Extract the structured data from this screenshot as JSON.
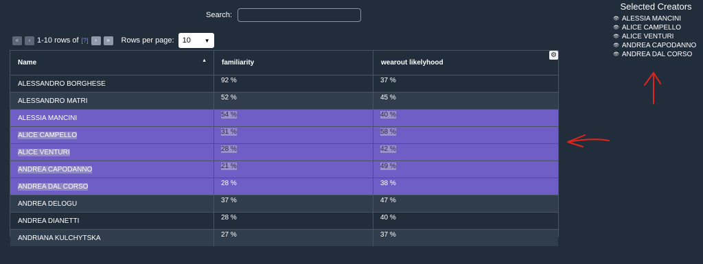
{
  "search": {
    "label": "Search:",
    "value": ""
  },
  "pager": {
    "first_icon": "double-chevron-left",
    "prev_icon": "chevron-left",
    "next_icon": "chevron-right",
    "last_icon": "double-chevron-right",
    "range_text": "1-10 rows of",
    "total_text": "[?]",
    "rows_per_page_label": "Rows per page:",
    "rows_per_page_value": "10"
  },
  "table": {
    "columns": [
      "Name",
      "familiarity",
      "wearout likelyhood"
    ],
    "sort": {
      "column": "Name",
      "direction": "ascending"
    },
    "rows": [
      {
        "name": "ALESSANDRO BORGHESE",
        "familiarity": "92 %",
        "wearout": "37 %",
        "selected": false
      },
      {
        "name": "ALESSANDRO MATRI",
        "familiarity": "52 %",
        "wearout": "45 %",
        "selected": false
      },
      {
        "name": "ALESSIA MANCINI",
        "familiarity": "54 %",
        "wearout": "40 %",
        "selected": true
      },
      {
        "name": "ALICE CAMPELLO",
        "familiarity": "31 %",
        "wearout": "58 %",
        "selected": true
      },
      {
        "name": "ALICE VENTURI",
        "familiarity": "28 %",
        "wearout": "42 %",
        "selected": true
      },
      {
        "name": "ANDREA CAPODANNO",
        "familiarity": "21 %",
        "wearout": "49 %",
        "selected": true
      },
      {
        "name": "ANDREA DAL CORSO",
        "familiarity": "28 %",
        "wearout": "38 %",
        "selected": true
      },
      {
        "name": "ANDREA DELOGU",
        "familiarity": "37 %",
        "wearout": "47 %",
        "selected": false
      },
      {
        "name": "ANDREA DIANETTI",
        "familiarity": "28 %",
        "wearout": "40 %",
        "selected": false
      },
      {
        "name": "ANDRIANA KULCHYTSKA",
        "familiarity": "27 %",
        "wearout": "37 %",
        "selected": false
      }
    ]
  },
  "selected_creators": {
    "title": "Selected Creators",
    "items": [
      "ALESSIA MANCINI",
      "ALICE CAMPELLO",
      "ALICE VENTURI",
      "ANDREA CAPODANNO",
      "ANDREA DAL CORSO"
    ]
  },
  "annotations": {
    "arrow_color": "#e0261c"
  },
  "colors": {
    "background": "#222d3c",
    "row_alt": "#303d4d",
    "selected_row": "#6f5ec6",
    "highlight": "#9a91cc"
  }
}
